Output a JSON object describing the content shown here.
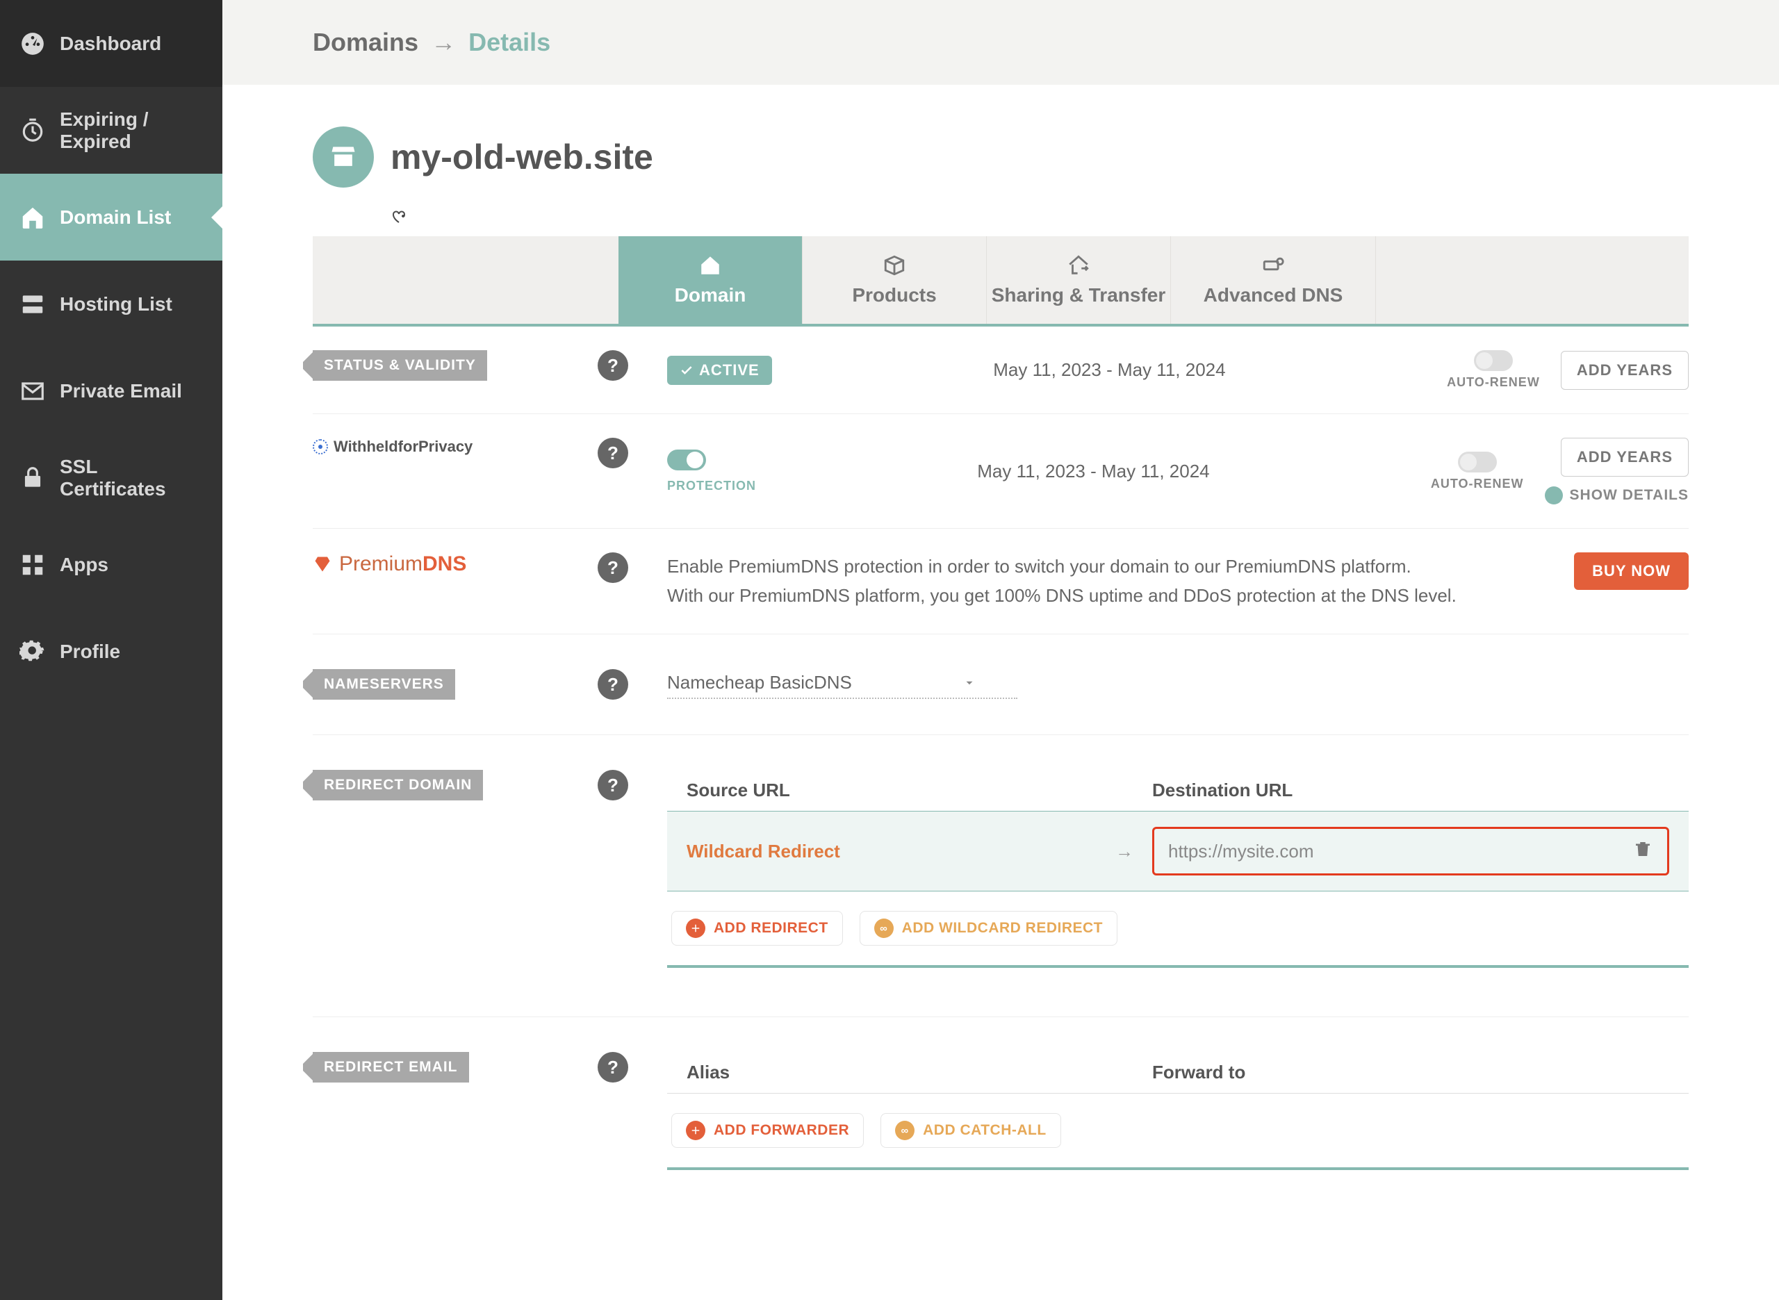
{
  "breadcrumb": {
    "root": "Domains",
    "sep": "→",
    "current": "Details"
  },
  "sidebar": {
    "items": [
      {
        "label": "Dashboard"
      },
      {
        "label": "Expiring / Expired"
      },
      {
        "label": "Domain List"
      },
      {
        "label": "Hosting List"
      },
      {
        "label": "Private Email"
      },
      {
        "label": "SSL Certificates"
      },
      {
        "label": "Apps"
      },
      {
        "label": "Profile"
      }
    ]
  },
  "domain": {
    "name": "my-old-web.site"
  },
  "tabs": [
    {
      "label": "Domain"
    },
    {
      "label": "Products"
    },
    {
      "label": "Sharing & Transfer"
    },
    {
      "label": "Advanced DNS"
    }
  ],
  "status": {
    "tag": "STATUS & VALIDITY",
    "badge": "ACTIVE",
    "dates": "May 11, 2023 - May 11, 2024",
    "autorenew": "AUTO-RENEW",
    "add_years": "ADD YEARS"
  },
  "privacy": {
    "logo": "WithheldforPrivacy",
    "protection": "PROTECTION",
    "dates": "May 11, 2023 - May 11, 2024",
    "autorenew": "AUTO-RENEW",
    "add_years": "ADD YEARS",
    "show_details": "SHOW DETAILS"
  },
  "premium": {
    "brand_pre": "Premium",
    "brand_bold": "DNS",
    "line1": "Enable PremiumDNS protection in order to switch your domain to our PremiumDNS platform.",
    "line2": "With our PremiumDNS platform, you get 100% DNS uptime and DDoS protection at the DNS level.",
    "buy": "BUY NOW"
  },
  "nameservers": {
    "tag": "NAMESERVERS",
    "value": "Namecheap BasicDNS"
  },
  "redirect_domain": {
    "tag": "REDIRECT DOMAIN",
    "source_col": "Source URL",
    "dest_col": "Destination URL",
    "wildcard": "Wildcard Redirect",
    "arrow": "→",
    "dest_value": "https://mysite.com",
    "add_redirect": "ADD REDIRECT",
    "add_wildcard": "ADD WILDCARD REDIRECT"
  },
  "redirect_email": {
    "tag": "REDIRECT EMAIL",
    "alias_col": "Alias",
    "forward_col": "Forward to",
    "add_forwarder": "ADD FORWARDER",
    "add_catch_all": "ADD CATCH-ALL"
  },
  "help": "?"
}
